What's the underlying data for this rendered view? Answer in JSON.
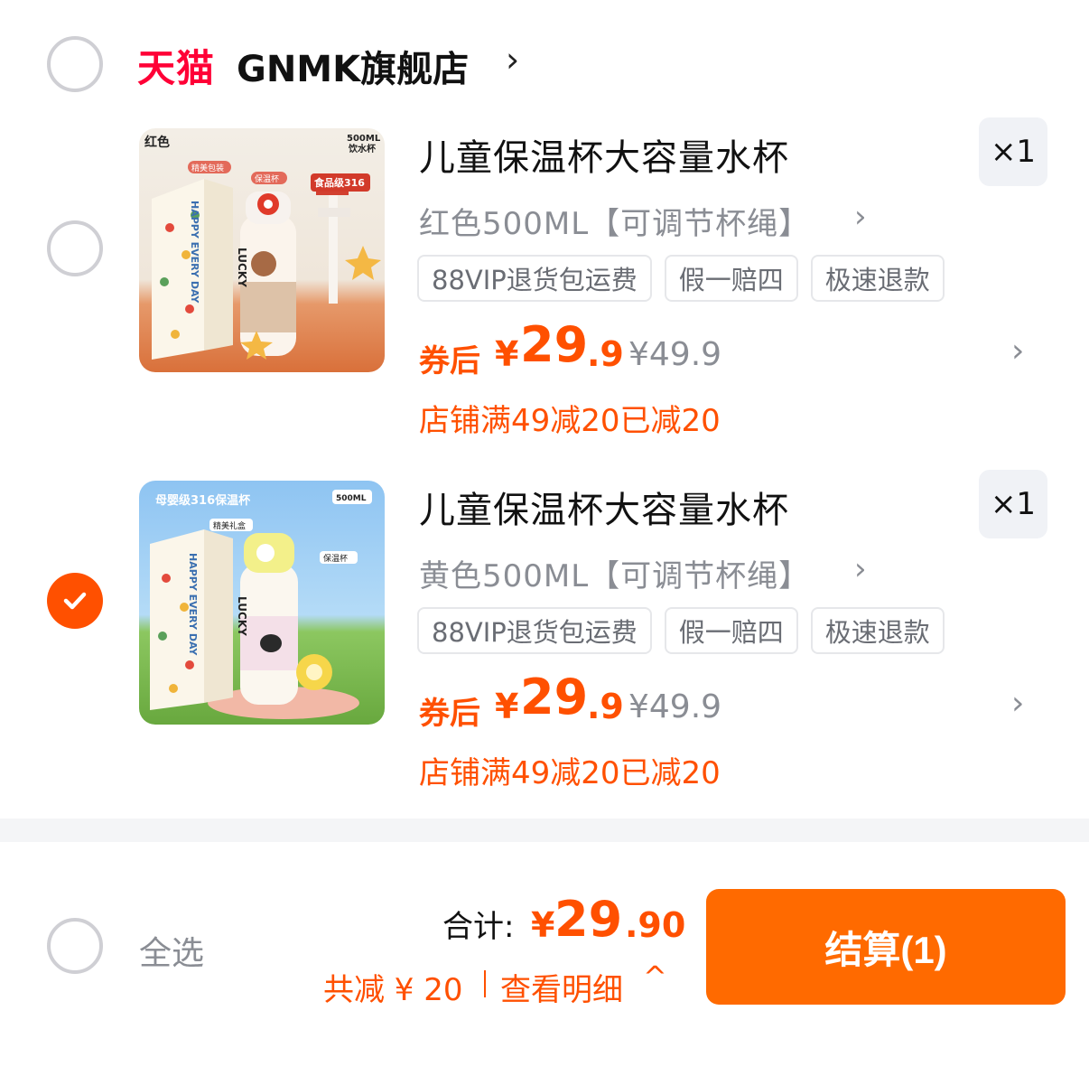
{
  "shop": {
    "logo": "天猫",
    "name": "GNMK旗舰店",
    "chevron": "›"
  },
  "items": [
    {
      "selected": false,
      "title": "儿童保温杯大容量水杯",
      "quantity": "×1",
      "spec": "红色500ML【可调节杯绳】",
      "spec_chevron": "›",
      "tags": [
        "88VIP退货包运费",
        "假一赔四",
        "极速退款"
      ],
      "price_prefix": "券后",
      "price_symbol": "¥",
      "price_int": "29",
      "price_dec": ".9",
      "price_original": "¥49.9",
      "promo": "店铺满49减20已减20",
      "thumb": {
        "color_label": "红色",
        "size_label": "500ML",
        "size_sub": "饮水杯",
        "box_badge": "精美包装",
        "cup_badge": "保温杯",
        "grade_badge": "食品级316",
        "cup_text": "LUCKY",
        "box_text": "HAPPY EVERY DAY",
        "bg_top": "#f1ece4",
        "bg_bottom": "#e2814a"
      }
    },
    {
      "selected": true,
      "title": "儿童保温杯大容量水杯",
      "quantity": "×1",
      "spec": "黄色500ML【可调节杯绳】",
      "spec_chevron": "›",
      "tags": [
        "88VIP退货包运费",
        "假一赔四",
        "极速退款"
      ],
      "price_prefix": "券后",
      "price_symbol": "¥",
      "price_int": "29",
      "price_dec": ".9",
      "price_original": "¥49.9",
      "promo": "店铺满49减20已减20",
      "thumb": {
        "header": "母婴级316保温杯",
        "size_label": "500ML",
        "box_badge": "精美礼盒",
        "cup_badge": "保温杯",
        "cup_text": "LUCKY",
        "box_text": "HAPPY EVERY DAY",
        "bg_top": "#8fc2f0",
        "bg_bottom": "#7bbd4e"
      }
    }
  ],
  "footer": {
    "select_all_label": "全选",
    "total_label": "合计:",
    "total_symbol": "¥",
    "total_int": "29",
    "total_dec": ".90",
    "saved_text": "共减 ¥ 20",
    "detail_text": "查看明细",
    "detail_chevron": "^",
    "checkout_label": "结算(1)"
  },
  "colors": {
    "accent": "#ff5000",
    "tmall_red": "#ff0036",
    "checkout": "#ff6a00",
    "muted": "#8a8d94"
  }
}
